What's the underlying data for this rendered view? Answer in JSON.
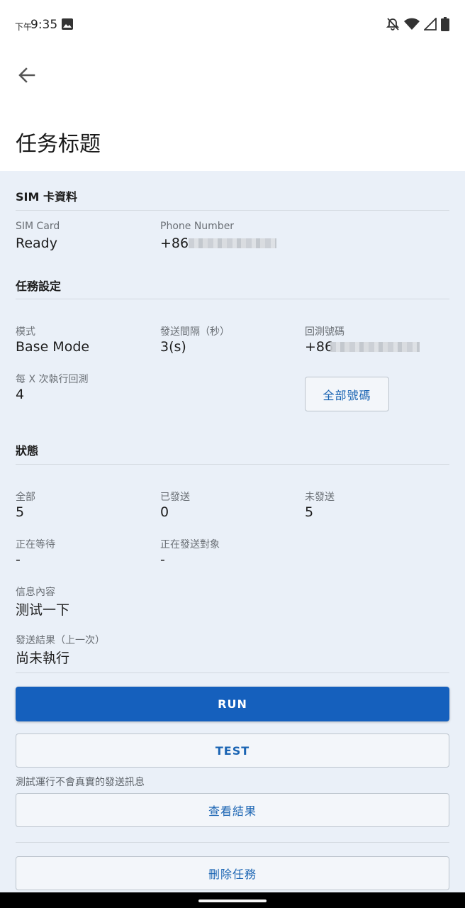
{
  "status_bar": {
    "time_prefix": "下午",
    "time": "9:35"
  },
  "header": {
    "title": "任务标题"
  },
  "sim_section": {
    "title": "SIM 卡資料",
    "sim_card_label": "SIM Card",
    "sim_card_value": "Ready",
    "phone_label": "Phone Number",
    "phone_value": "+86"
  },
  "task_settings": {
    "title": "任務設定",
    "mode_label": "模式",
    "mode_value": "Base Mode",
    "interval_label": "發送間隔（秒）",
    "interval_value": "3(s)",
    "callback_label": "回測號碼",
    "callback_value": "+86",
    "every_x_label": "每 X 次執行回測",
    "every_x_value": "4",
    "all_numbers_button": "全部號碼"
  },
  "status_section": {
    "title": "狀態",
    "total_label": "全部",
    "total_value": "5",
    "sent_label": "已發送",
    "sent_value": "0",
    "unsent_label": "未發送",
    "unsent_value": "5",
    "waiting_label": "正在等待",
    "waiting_value": "-",
    "sending_target_label": "正在發送對象",
    "sending_target_value": "-",
    "message_label": "信息內容",
    "message_value": "测试一下",
    "result_label": "發送結果（上一次）",
    "result_value": "尚未執行"
  },
  "actions": {
    "run": "RUN",
    "test": "TEST",
    "test_hint": "測試運行不會真實的發送訊息",
    "view_results": "查看結果",
    "delete_task": "刪除任務"
  },
  "colors": {
    "accent": "#1560bd",
    "background": "#eaf0f8"
  },
  "icons": [
    "image-icon",
    "bell-off-icon",
    "wifi-icon",
    "signal-icon",
    "battery-icon",
    "back-arrow-icon"
  ]
}
